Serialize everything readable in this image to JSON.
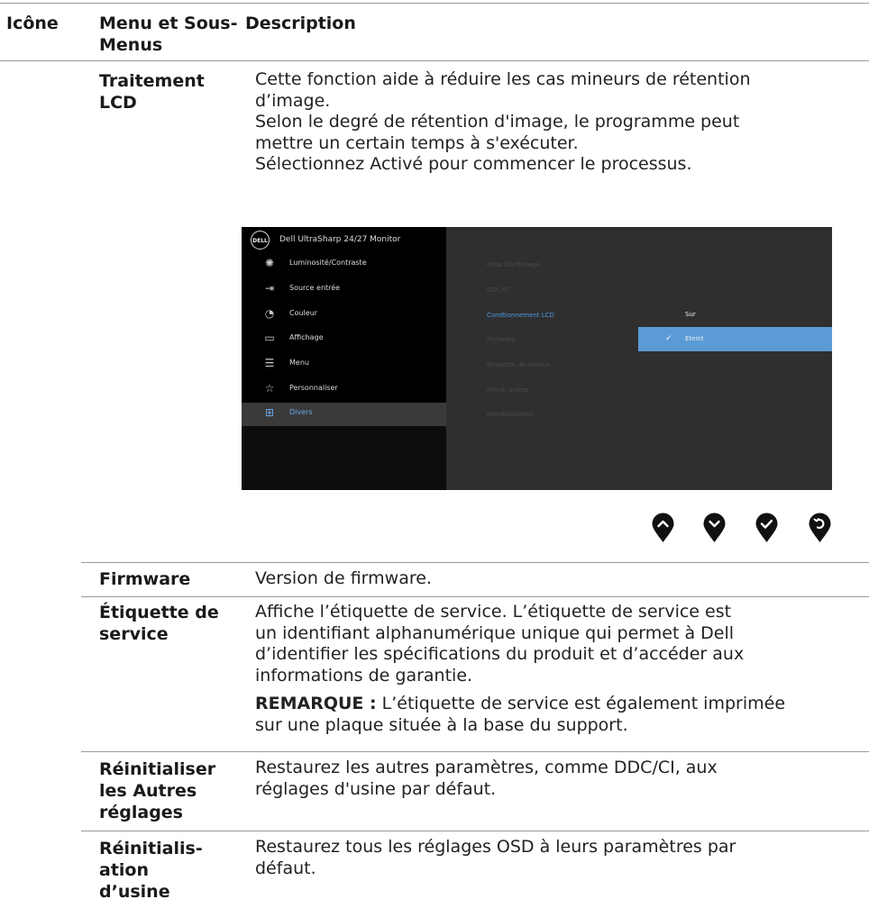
{
  "header": {
    "col1": "Icône",
    "col2_line1": "Menu et Sous-",
    "col2_line2": "Menus",
    "col3": "Description"
  },
  "lcd": {
    "term_line1": "Traitement",
    "term_line2": "LCD",
    "desc_lines": [
      "Cette fonction aide à réduire les cas mineurs de rétention",
      "d’image.",
      "Selon le degré de rétention d'image, le programme peut",
      "mettre un certain temps à s'exécuter.",
      "Sélectionnez Activé pour commencer le processus."
    ]
  },
  "osd": {
    "logo": "DELL",
    "title": "Dell UltraSharp 24/27 Monitor",
    "menu": [
      {
        "icon": "brightness-icon",
        "glyph": "✺",
        "label": "Luminosité/Contraste"
      },
      {
        "icon": "input-source-icon",
        "glyph": "⇥",
        "label": "Source entrée"
      },
      {
        "icon": "color-icon",
        "glyph": "◔",
        "label": "Couleur"
      },
      {
        "icon": "display-icon",
        "glyph": "▭",
        "label": "Affichage"
      },
      {
        "icon": "menu-icon",
        "glyph": "☰",
        "label": "Menu"
      },
      {
        "icon": "star-icon",
        "glyph": "☆",
        "label": "Personnaliser"
      },
      {
        "icon": "others-icon",
        "glyph": "⊞",
        "label": "Divers"
      }
    ],
    "submenu": [
      "Infos D'affichage",
      "DDC/CI",
      "Condtionnement LCD",
      "Firmware",
      "Étiquette de service",
      "Réinit. autres",
      "Réinitialisation"
    ],
    "options": [
      "Sur",
      "Eteint"
    ],
    "check_glyph": "✓",
    "accent": "#5b9bd5"
  },
  "nav_buttons": [
    {
      "icon": "up-icon",
      "glyph": "⌃"
    },
    {
      "icon": "down-icon",
      "glyph": "⌄"
    },
    {
      "icon": "check-icon",
      "glyph": "✓"
    },
    {
      "icon": "back-icon",
      "glyph": "↺"
    }
  ],
  "rows": {
    "firmware": {
      "term": "Firmware",
      "desc": "Version de firmware."
    },
    "service": {
      "term_line1": "Étiquette de",
      "term_line2": "service",
      "desc_lines": [
        "Affiche l’étiquette de service. L’étiquette de service est",
        "un identifiant alphanumérique unique qui permet à Dell",
        "d’identifier les spécifications du produit et d’accéder aux",
        "informations de garantie."
      ],
      "note_label": "REMARQUE :",
      "note_line1": " L’étiquette de service est également imprimée",
      "note_line2": "sur une plaque située à la base du support."
    },
    "reset_others": {
      "term_lines": [
        "Réinitialiser",
        "les Autres",
        "réglages"
      ],
      "desc_lines": [
        "Restaurez les autres paramètres, comme DDC/CI, aux",
        "réglages d'usine par défaut."
      ]
    },
    "factory_reset": {
      "term_lines": [
        "Réinitialis-",
        "ation",
        "d’usine"
      ],
      "desc_lines": [
        "Restaurez tous les réglages OSD à leurs paramètres par",
        "défaut."
      ]
    }
  }
}
